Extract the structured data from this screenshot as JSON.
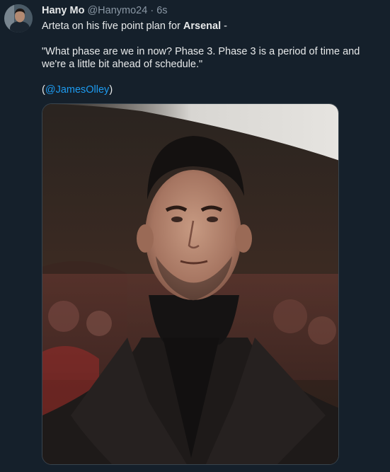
{
  "tweet": {
    "author": {
      "display_name": "Hany Mo",
      "handle": "@Hanymo24",
      "separator": "·",
      "time": "6s"
    },
    "text_line1_start": "Arteta on his five point plan for ",
    "text_line1_bold": "Arsenal",
    "text_line1_end": " -",
    "quote": "\"What phase are we in now? Phase 3. Phase 3 is a period of time and we're a little bit ahead of schedule.\"",
    "mention_open": "(",
    "mention": "@JamesOlley",
    "mention_close": ")"
  },
  "colors": {
    "background": "#15202b",
    "text": "#e7e9ea",
    "muted": "#8b98a5",
    "link": "#1d9bf0"
  }
}
